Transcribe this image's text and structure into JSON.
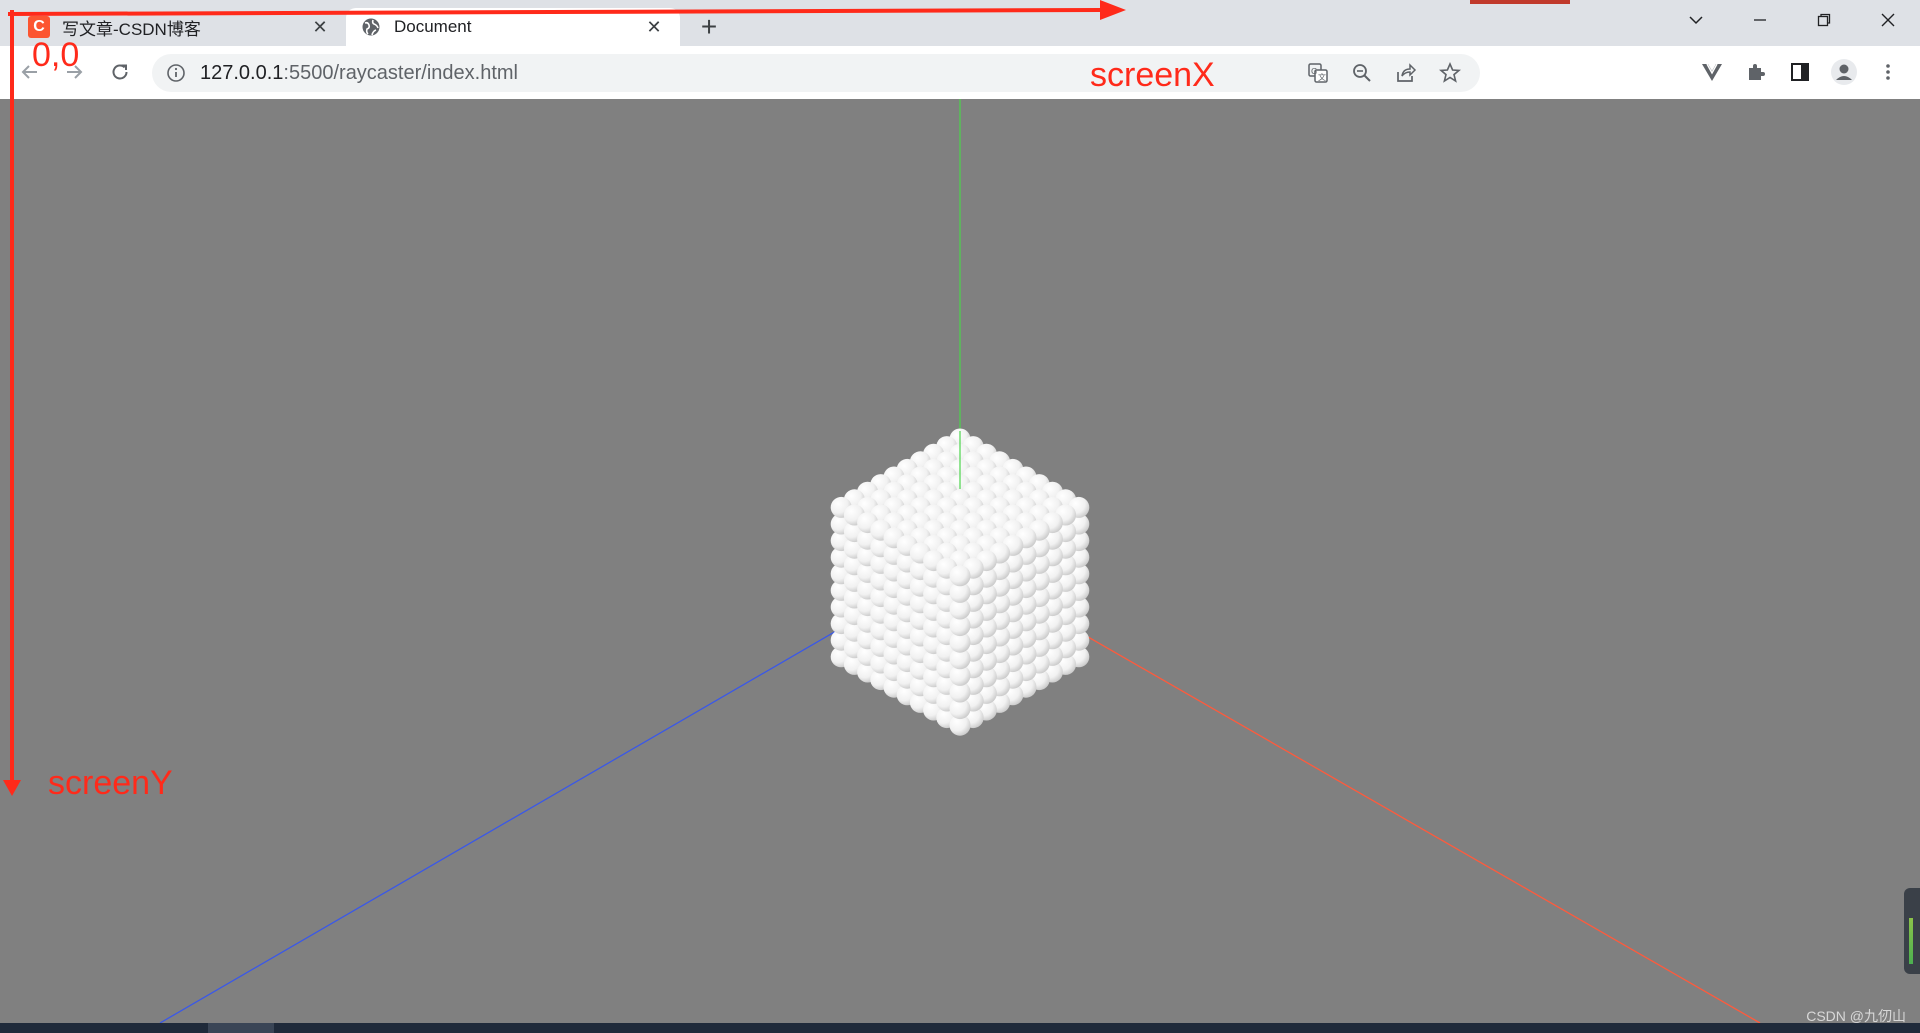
{
  "browser": {
    "tabs": [
      {
        "title": "写文章-CSDN博客",
        "favicon": "csdn-logo-icon",
        "favicon_text": "C",
        "active": false
      },
      {
        "title": "Document",
        "favicon": "globe-icon",
        "active": true
      }
    ],
    "new_tab_label": "+",
    "address": {
      "host": "127.0.0.1",
      "path": ":5500/raycaster/index.html"
    },
    "window_controls": [
      "tab-search-icon",
      "minimize-icon",
      "restore-icon",
      "close-icon"
    ],
    "omnibox_icons": [
      "translate-icon",
      "zoom-out-icon",
      "share-icon",
      "bookmark-star-icon"
    ],
    "toolbar_icons": [
      "vue-devtools-icon",
      "extensions-puzzle-icon",
      "side-panel-icon",
      "profile-avatar-icon",
      "menu-kebab-icon"
    ]
  },
  "annotations": {
    "origin": "0,0",
    "screen_x": "screenX",
    "screen_y": "screenY",
    "color": "#ff2a1a"
  },
  "scene": {
    "background": "#808080",
    "axis_colors": {
      "x": "#ff5a3c",
      "y": "#4cd44c",
      "z": "#3a58e8"
    },
    "object": "sphere-cube"
  },
  "watermark": "CSDN @九仞山"
}
